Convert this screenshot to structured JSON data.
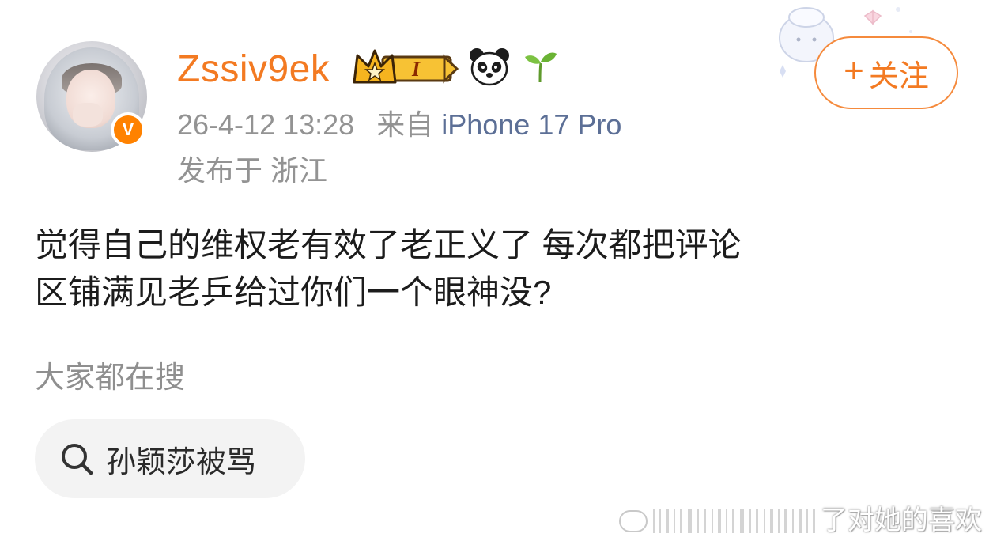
{
  "user": {
    "name": "Zssiv9ek",
    "verified_badge": "V",
    "level_label": "I"
  },
  "meta": {
    "time": "26-4-12 13:28",
    "source_prefix": "来自",
    "device": "iPhone 17 Pro",
    "location": "发布于 浙江"
  },
  "follow": {
    "plus": "+",
    "label": "关注"
  },
  "post": {
    "text_line1": "觉得自己的维权老有效了老正义了 每次都把评论",
    "text_line2": "区铺满见老乒给过你们一个眼神没?"
  },
  "search": {
    "heading": "大家都在搜",
    "chip_label": "孙颖莎被骂"
  },
  "watermark": {
    "text": "了对她的喜欢"
  },
  "colors": {
    "accent": "#f37a22",
    "meta_gray": "#939393",
    "device_link": "#5c6f96",
    "chip_bg": "#f3f3f3"
  },
  "icons": [
    "crown-icon",
    "panda-icon",
    "sprout-icon",
    "search-icon",
    "verified-icon"
  ]
}
